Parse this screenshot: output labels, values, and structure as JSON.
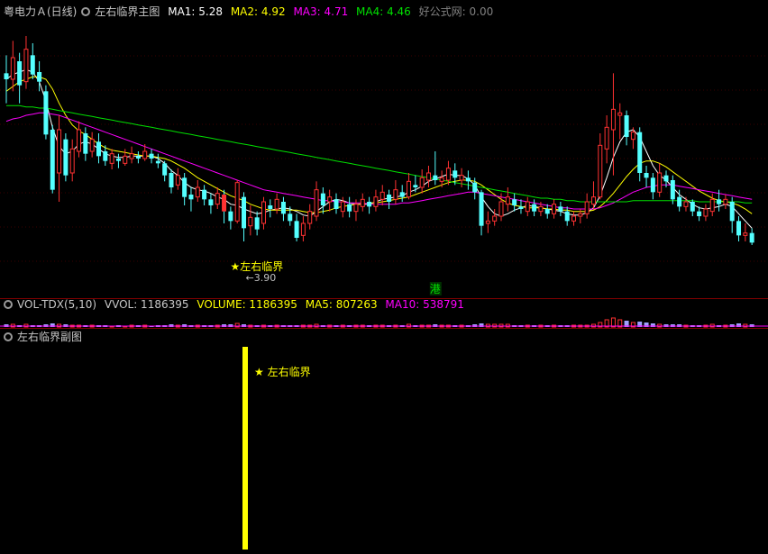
{
  "main_legend": {
    "stock": "粤电力Ａ(日线)",
    "indicator": "左右临界主图",
    "ma1": "MA1: 5.28",
    "ma2": "MA2: 4.92",
    "ma3": "MA3: 4.71",
    "ma4": "MA4: 4.46",
    "source": "好公式网: 0.00"
  },
  "vol_legend": {
    "indicator": "VOL-TDX(5,10)",
    "vvol": "VVOL: 1186395",
    "volume": "VOLUME: 1186395",
    "ma5": "MA5: 807263",
    "ma10": "MA10: 538791"
  },
  "sub_legend": {
    "indicator": "左右临界副图"
  },
  "colors": {
    "up": "#ff3232",
    "down": "#54ffff",
    "ma1": "#ffffff",
    "ma2": "#ffff00",
    "ma3": "#ff00ff",
    "ma4": "#00e000",
    "signal": "#ffff00",
    "hk": "#00e000"
  },
  "chart_data": {
    "type": "candlestick",
    "price_range": [
      3.6,
      5.85
    ],
    "candles": [
      [
        5.45,
        5.4,
        5.6,
        5.2
      ],
      [
        5.4,
        5.58,
        5.72,
        5.3
      ],
      [
        5.55,
        5.35,
        5.62,
        5.2
      ],
      [
        5.38,
        5.65,
        5.76,
        5.32
      ],
      [
        5.6,
        5.44,
        5.7,
        5.4
      ],
      [
        5.46,
        5.38,
        5.55,
        5.3
      ],
      [
        5.3,
        4.94,
        5.35,
        4.9
      ],
      [
        4.98,
        4.48,
        5.02,
        4.45
      ],
      [
        4.62,
        4.98,
        5.1,
        4.38
      ],
      [
        4.9,
        4.6,
        4.95,
        4.55
      ],
      [
        4.62,
        4.82,
        4.9,
        4.55
      ],
      [
        4.8,
        4.98,
        5.05,
        4.75
      ],
      [
        4.95,
        4.78,
        5.0,
        4.72
      ],
      [
        4.8,
        4.9,
        4.96,
        4.75
      ],
      [
        4.88,
        4.76,
        4.95,
        4.7
      ],
      [
        4.8,
        4.72,
        4.85,
        4.68
      ],
      [
        4.7,
        4.78,
        4.82,
        4.65
      ],
      [
        4.74,
        4.72,
        4.78,
        4.66
      ],
      [
        4.7,
        4.76,
        4.82,
        4.68
      ],
      [
        4.74,
        4.78,
        4.84,
        4.7
      ],
      [
        4.76,
        4.74,
        4.8,
        4.7
      ],
      [
        4.74,
        4.8,
        4.86,
        4.72
      ],
      [
        4.78,
        4.74,
        4.82,
        4.7
      ],
      [
        4.72,
        4.7,
        4.78,
        4.66
      ],
      [
        4.7,
        4.6,
        4.72,
        4.55
      ],
      [
        4.62,
        4.5,
        4.65,
        4.45
      ],
      [
        4.52,
        4.6,
        4.66,
        4.48
      ],
      [
        4.58,
        4.42,
        4.62,
        4.35
      ],
      [
        4.44,
        4.4,
        4.5,
        4.3
      ],
      [
        4.42,
        4.5,
        4.56,
        4.38
      ],
      [
        4.48,
        4.4,
        4.52,
        4.35
      ],
      [
        4.4,
        4.35,
        4.45,
        4.28
      ],
      [
        4.36,
        4.45,
        4.5,
        4.32
      ],
      [
        4.44,
        4.3,
        4.48,
        4.2
      ],
      [
        4.3,
        4.22,
        4.34,
        4.15
      ],
      [
        4.22,
        4.54,
        4.56,
        4.2
      ],
      [
        4.42,
        4.16,
        4.46,
        4.05
      ],
      [
        4.18,
        4.25,
        4.35,
        4.1
      ],
      [
        4.25,
        4.15,
        4.3,
        4.1
      ],
      [
        4.2,
        4.38,
        4.42,
        4.15
      ],
      [
        4.35,
        4.32,
        4.4,
        4.25
      ],
      [
        4.32,
        4.4,
        4.45,
        4.28
      ],
      [
        4.38,
        4.28,
        4.42,
        4.22
      ],
      [
        4.28,
        4.22,
        4.34,
        4.18
      ],
      [
        4.22,
        4.08,
        4.28,
        4.05
      ],
      [
        4.1,
        4.2,
        4.26,
        4.05
      ],
      [
        4.2,
        4.3,
        4.36,
        4.15
      ],
      [
        4.26,
        4.48,
        4.55,
        4.22
      ],
      [
        4.45,
        4.35,
        4.5,
        4.28
      ],
      [
        4.38,
        4.42,
        4.48,
        4.3
      ],
      [
        4.4,
        4.32,
        4.45,
        4.28
      ],
      [
        4.3,
        4.38,
        4.42,
        4.25
      ],
      [
        4.36,
        4.3,
        4.42,
        4.25
      ],
      [
        4.3,
        4.36,
        4.4,
        4.22
      ],
      [
        4.34,
        4.4,
        4.45,
        4.3
      ],
      [
        4.38,
        4.34,
        4.42,
        4.28
      ],
      [
        4.34,
        4.42,
        4.48,
        4.3
      ],
      [
        4.4,
        4.46,
        4.52,
        4.35
      ],
      [
        4.44,
        4.38,
        4.48,
        4.32
      ],
      [
        4.4,
        4.48,
        4.56,
        4.36
      ],
      [
        4.46,
        4.42,
        4.52,
        4.38
      ],
      [
        4.42,
        4.55,
        4.62,
        4.4
      ],
      [
        4.52,
        4.5,
        4.6,
        4.46
      ],
      [
        4.5,
        4.58,
        4.65,
        4.45
      ],
      [
        4.56,
        4.62,
        4.68,
        4.5
      ],
      [
        4.6,
        4.56,
        4.8,
        4.52
      ],
      [
        4.55,
        4.58,
        4.64,
        4.5
      ],
      [
        4.56,
        4.66,
        4.72,
        4.52
      ],
      [
        4.64,
        4.58,
        4.7,
        4.52
      ],
      [
        4.56,
        4.6,
        4.66,
        4.5
      ],
      [
        4.58,
        4.55,
        4.64,
        4.48
      ],
      [
        4.54,
        4.46,
        4.58,
        4.4
      ],
      [
        4.46,
        4.18,
        4.48,
        4.1
      ],
      [
        4.2,
        4.22,
        4.3,
        4.12
      ],
      [
        4.22,
        4.26,
        4.32,
        4.18
      ],
      [
        4.26,
        4.38,
        4.45,
        4.22
      ],
      [
        4.36,
        4.42,
        4.5,
        4.3
      ],
      [
        4.4,
        4.35,
        4.45,
        4.3
      ],
      [
        4.34,
        4.32,
        4.4,
        4.28
      ],
      [
        4.3,
        4.38,
        4.42,
        4.26
      ],
      [
        4.36,
        4.3,
        4.4,
        4.26
      ],
      [
        4.3,
        4.34,
        4.38,
        4.26
      ],
      [
        4.32,
        4.28,
        4.36,
        4.24
      ],
      [
        4.28,
        4.36,
        4.4,
        4.24
      ],
      [
        4.34,
        4.3,
        4.38,
        4.26
      ],
      [
        4.3,
        4.22,
        4.34,
        4.18
      ],
      [
        4.22,
        4.26,
        4.3,
        4.18
      ],
      [
        4.26,
        4.28,
        4.32,
        4.2
      ],
      [
        4.28,
        4.38,
        4.45,
        4.24
      ],
      [
        4.36,
        4.42,
        4.55,
        4.32
      ],
      [
        4.42,
        4.85,
        4.95,
        4.4
      ],
      [
        4.82,
        5.0,
        5.1,
        4.7
      ],
      [
        4.98,
        5.15,
        5.45,
        4.6
      ],
      [
        5.1,
        5.12,
        5.2,
        4.9
      ],
      [
        5.1,
        4.92,
        5.14,
        4.85
      ],
      [
        4.9,
        4.96,
        5.0,
        4.82
      ],
      [
        4.96,
        4.62,
        5.0,
        4.55
      ],
      [
        4.62,
        4.58,
        4.68,
        4.5
      ],
      [
        4.58,
        4.46,
        4.62,
        4.4
      ],
      [
        4.46,
        4.62,
        4.7,
        4.42
      ],
      [
        4.6,
        4.55,
        4.64,
        4.5
      ],
      [
        4.56,
        4.4,
        4.6,
        4.36
      ],
      [
        4.42,
        4.34,
        4.48,
        4.3
      ],
      [
        4.34,
        4.38,
        4.42,
        4.3
      ],
      [
        4.38,
        4.3,
        4.4,
        4.26
      ],
      [
        4.3,
        4.26,
        4.34,
        4.22
      ],
      [
        4.26,
        4.32,
        4.36,
        4.22
      ],
      [
        4.3,
        4.4,
        4.45,
        4.26
      ],
      [
        4.4,
        4.36,
        4.48,
        4.3
      ],
      [
        4.36,
        4.4,
        4.44,
        4.32
      ],
      [
        4.38,
        4.22,
        4.42,
        4.12
      ],
      [
        4.22,
        4.1,
        4.26,
        4.05
      ],
      [
        4.1,
        4.12,
        4.2,
        4.05
      ],
      [
        4.12,
        4.04,
        4.16,
        4.02
      ]
    ],
    "ma_series": [
      {
        "name": "MA1",
        "values": [
          5.4,
          5.44,
          5.46,
          5.48,
          5.46,
          5.38,
          5.22,
          5.0,
          4.84,
          4.78,
          4.8,
          4.86,
          4.88,
          4.86,
          4.82,
          4.78,
          4.76,
          4.75,
          4.75,
          4.76,
          4.76,
          4.76,
          4.76,
          4.74,
          4.7,
          4.64,
          4.6,
          4.54,
          4.5,
          4.48,
          4.47,
          4.45,
          4.42,
          4.4,
          4.36,
          4.35,
          4.32,
          4.3,
          4.28,
          4.29,
          4.31,
          4.32,
          4.33,
          4.32,
          4.3,
          4.27,
          4.26,
          4.3,
          4.34,
          4.38,
          4.4,
          4.39,
          4.37,
          4.36,
          4.36,
          4.36,
          4.38,
          4.4,
          4.41,
          4.42,
          4.43,
          4.46,
          4.48,
          4.51,
          4.55,
          4.57,
          4.59,
          4.61,
          4.6,
          4.6,
          4.57,
          4.52,
          4.42,
          4.34,
          4.28,
          4.26,
          4.28,
          4.31,
          4.33,
          4.35,
          4.34,
          4.33,
          4.32,
          4.31,
          4.3,
          4.28,
          4.27,
          4.27,
          4.29,
          4.33,
          4.43,
          4.58,
          4.75,
          4.88,
          4.96,
          4.98,
          4.92,
          4.8,
          4.68,
          4.6,
          4.56,
          4.5,
          4.44,
          4.4,
          4.36,
          4.33,
          4.32,
          4.33,
          4.34,
          4.36,
          4.34,
          4.28,
          4.22,
          4.16
        ]
      },
      {
        "name": "MA2",
        "values": [
          5.3,
          5.34,
          5.38,
          5.4,
          5.42,
          5.42,
          5.4,
          5.32,
          5.2,
          5.1,
          5.02,
          4.97,
          4.94,
          4.9,
          4.86,
          4.83,
          4.81,
          4.8,
          4.79,
          4.78,
          4.77,
          4.76,
          4.76,
          4.75,
          4.74,
          4.72,
          4.69,
          4.66,
          4.62,
          4.58,
          4.55,
          4.52,
          4.49,
          4.46,
          4.43,
          4.41,
          4.39,
          4.36,
          4.34,
          4.32,
          4.31,
          4.31,
          4.31,
          4.31,
          4.31,
          4.3,
          4.29,
          4.29,
          4.3,
          4.31,
          4.33,
          4.34,
          4.35,
          4.36,
          4.36,
          4.37,
          4.37,
          4.38,
          4.39,
          4.4,
          4.41,
          4.42,
          4.44,
          4.46,
          4.48,
          4.5,
          4.52,
          4.54,
          4.55,
          4.56,
          4.56,
          4.55,
          4.52,
          4.48,
          4.44,
          4.4,
          4.37,
          4.35,
          4.34,
          4.33,
          4.33,
          4.33,
          4.32,
          4.32,
          4.31,
          4.31,
          4.3,
          4.3,
          4.3,
          4.31,
          4.34,
          4.39,
          4.45,
          4.52,
          4.59,
          4.65,
          4.7,
          4.72,
          4.72,
          4.7,
          4.67,
          4.63,
          4.59,
          4.55,
          4.51,
          4.47,
          4.44,
          4.41,
          4.39,
          4.38,
          4.37,
          4.35,
          4.32,
          4.28
        ]
      },
      {
        "name": "MA3",
        "values": [
          5.05,
          5.07,
          5.08,
          5.1,
          5.11,
          5.12,
          5.12,
          5.11,
          5.1,
          5.08,
          5.06,
          5.04,
          5.02,
          5.0,
          4.98,
          4.96,
          4.94,
          4.92,
          4.9,
          4.88,
          4.86,
          4.84,
          4.82,
          4.8,
          4.78,
          4.76,
          4.74,
          4.72,
          4.7,
          4.68,
          4.66,
          4.64,
          4.62,
          4.6,
          4.58,
          4.56,
          4.54,
          4.52,
          4.5,
          4.48,
          4.47,
          4.46,
          4.45,
          4.44,
          4.43,
          4.42,
          4.41,
          4.4,
          4.39,
          4.39,
          4.38,
          4.38,
          4.37,
          4.37,
          4.37,
          4.36,
          4.36,
          4.36,
          4.36,
          4.36,
          4.37,
          4.37,
          4.38,
          4.39,
          4.4,
          4.41,
          4.42,
          4.43,
          4.44,
          4.45,
          4.46,
          4.46,
          4.45,
          4.44,
          4.43,
          4.42,
          4.41,
          4.4,
          4.39,
          4.38,
          4.37,
          4.36,
          4.35,
          4.34,
          4.33,
          4.33,
          4.32,
          4.32,
          4.32,
          4.32,
          4.33,
          4.35,
          4.37,
          4.4,
          4.43,
          4.46,
          4.48,
          4.5,
          4.51,
          4.52,
          4.52,
          4.52,
          4.51,
          4.5,
          4.49,
          4.48,
          4.47,
          4.46,
          4.45,
          4.44,
          4.43,
          4.42,
          4.41,
          4.4
        ]
      },
      {
        "name": "MA4",
        "values": [
          5.18,
          5.18,
          5.18,
          5.17,
          5.17,
          5.16,
          5.16,
          5.15,
          5.14,
          5.13,
          5.12,
          5.11,
          5.1,
          5.09,
          5.08,
          5.07,
          5.06,
          5.05,
          5.04,
          5.03,
          5.02,
          5.01,
          5.0,
          4.99,
          4.98,
          4.97,
          4.96,
          4.95,
          4.94,
          4.93,
          4.92,
          4.91,
          4.9,
          4.89,
          4.88,
          4.87,
          4.86,
          4.85,
          4.84,
          4.83,
          4.82,
          4.81,
          4.8,
          4.79,
          4.78,
          4.77,
          4.76,
          4.75,
          4.74,
          4.73,
          4.72,
          4.71,
          4.7,
          4.69,
          4.68,
          4.67,
          4.66,
          4.65,
          4.64,
          4.63,
          4.62,
          4.61,
          4.6,
          4.59,
          4.58,
          4.57,
          4.56,
          4.55,
          4.54,
          4.53,
          4.52,
          4.51,
          4.5,
          4.49,
          4.48,
          4.47,
          4.46,
          4.45,
          4.44,
          4.43,
          4.42,
          4.41,
          4.41,
          4.4,
          4.4,
          4.39,
          4.39,
          4.38,
          4.38,
          4.38,
          4.38,
          4.38,
          4.38,
          4.38,
          4.38,
          4.39,
          4.39,
          4.39,
          4.39,
          4.39,
          4.39,
          4.39,
          4.39,
          4.39,
          4.39,
          4.38,
          4.38,
          4.38,
          4.38,
          4.38,
          4.38,
          4.38,
          4.37,
          4.37
        ]
      }
    ],
    "volume": [
      3,
      3,
      2,
      3,
      2,
      2,
      3,
      4,
      3,
      3,
      2,
      2,
      2,
      2,
      2,
      2,
      1,
      2,
      1,
      2,
      2,
      2,
      1,
      2,
      2,
      3,
      2,
      3,
      2,
      2,
      2,
      2,
      2,
      3,
      3,
      4,
      3,
      2,
      2,
      2,
      2,
      2,
      2,
      2,
      2,
      2,
      2,
      3,
      2,
      2,
      2,
      2,
      2,
      2,
      2,
      2,
      2,
      2,
      2,
      2,
      2,
      3,
      2,
      2,
      2,
      3,
      2,
      2,
      2,
      2,
      2,
      3,
      4,
      3,
      3,
      3,
      3,
      2,
      2,
      2,
      2,
      2,
      2,
      2,
      2,
      2,
      2,
      2,
      2,
      3,
      5,
      8,
      10,
      8,
      7,
      5,
      6,
      5,
      4,
      3,
      3,
      3,
      3,
      2,
      2,
      2,
      2,
      3,
      2,
      2,
      3,
      4,
      3,
      3
    ],
    "signal_index": 33,
    "signal_label": "★左右临界",
    "signal_price_label": "←3.90",
    "hk_index": 65,
    "hk_label": "港",
    "sub_signal_label": "★ 左右临界"
  }
}
